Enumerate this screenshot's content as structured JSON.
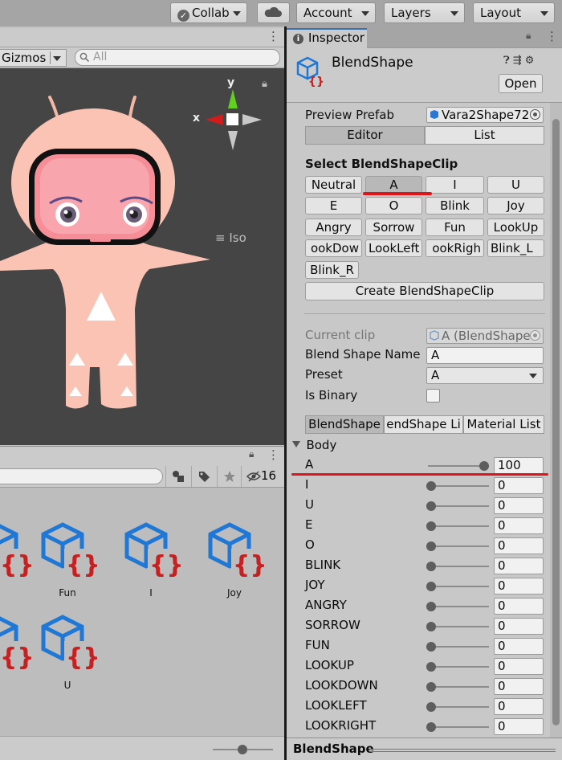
{
  "toolbar": {
    "collab_label": "Collab",
    "account_label": "Account",
    "layers_label": "Layers",
    "layout_label": "Layout"
  },
  "scene": {
    "gizmos_label": "Gizmos",
    "search_placeholder": "All",
    "axis_x": "x",
    "axis_y": "y",
    "projection_label": "Iso"
  },
  "project": {
    "hidden_count": "16",
    "assets": [
      {
        "label": ""
      },
      {
        "label": "Fun"
      },
      {
        "label": "I"
      },
      {
        "label": "Joy"
      },
      {
        "label": ""
      },
      {
        "label": "U"
      }
    ]
  },
  "inspector": {
    "tab_label": "Inspector",
    "component_title": "BlendShape",
    "open_label": "Open",
    "preview_prefab_label": "Preview Prefab",
    "preview_prefab_value": "Vara2Shape72",
    "tabs": [
      "Editor",
      "List"
    ],
    "select_clip_heading": "Select BlendShapeClip",
    "clip_buttons": [
      "Neutral",
      "A",
      "I",
      "U",
      "E",
      "O",
      "Blink",
      "Joy",
      "Angry",
      "Sorrow",
      "Fun",
      "LookUp",
      "ookDow",
      "LookLeft",
      "ookRigh",
      "Blink_L",
      "Blink_R"
    ],
    "selected_clip": "A",
    "create_label": "Create BlendShapeClip",
    "current_clip_label": "Current clip",
    "current_clip_value": "A (BlendShape",
    "blend_shape_name_label": "Blend Shape Name",
    "blend_shape_name_value": "A",
    "preset_label": "Preset",
    "preset_value": "A",
    "is_binary_label": "Is Binary",
    "is_binary": false,
    "sub_tabs": [
      "BlendShape",
      "endShape Li",
      "Material List"
    ],
    "group_label": "Body",
    "shapes": [
      {
        "name": "A",
        "value": "100"
      },
      {
        "name": "I",
        "value": "0"
      },
      {
        "name": "U",
        "value": "0"
      },
      {
        "name": "E",
        "value": "0"
      },
      {
        "name": "O",
        "value": "0"
      },
      {
        "name": "BLINK",
        "value": "0"
      },
      {
        "name": "JOY",
        "value": "0"
      },
      {
        "name": "ANGRY",
        "value": "0"
      },
      {
        "name": "SORROW",
        "value": "0"
      },
      {
        "name": "FUN",
        "value": "0"
      },
      {
        "name": "LOOKUP",
        "value": "0"
      },
      {
        "name": "LOOKDOWN",
        "value": "0"
      },
      {
        "name": "LOOKLEFT",
        "value": "0"
      },
      {
        "name": "LOOKRIGHT",
        "value": "0"
      }
    ],
    "preview_title": "BlendShape"
  },
  "colors": {
    "annotation_red": "#e0141a",
    "asset_blue": "#1f78d6",
    "asset_red": "#c62020",
    "gizmo_red": "#d21b1b",
    "gizmo_green": "#5fd11f"
  }
}
